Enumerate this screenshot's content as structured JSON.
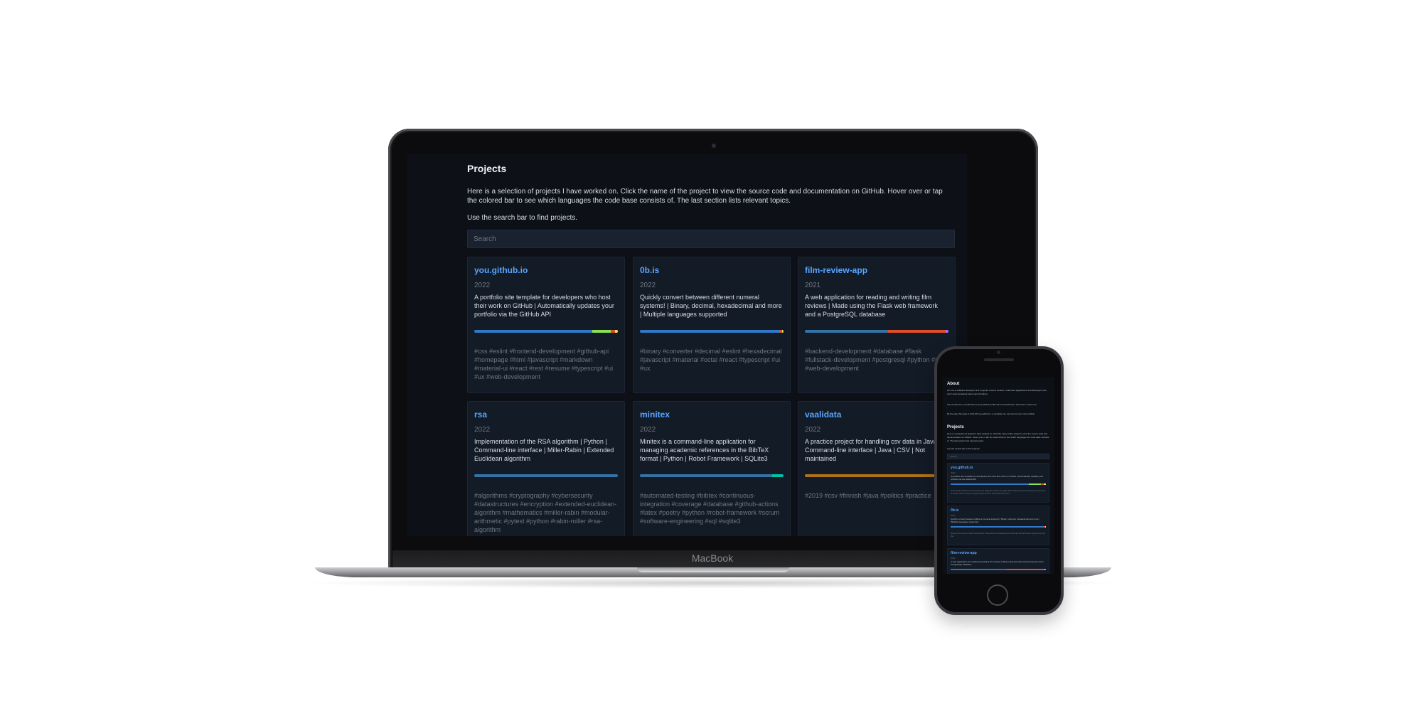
{
  "laptop": {
    "brand": "MacBook"
  },
  "projects": {
    "title": "Projects",
    "intro": "Here is a selection of projects I have worked on. Click the name of the project to view the source code and documentation on GitHub. Hover over or tap the colored bar to see which languages the code base consists of. The last section lists relevant topics.",
    "hint": "Use the search bar to find projects.",
    "search_placeholder": "Search",
    "cards": [
      {
        "name": "you.github.io",
        "year": "2022",
        "description": "A portfolio site template for developers who host their work on GitHub | Automatically updates your portfolio via the GitHub API",
        "topics": "#css #eslint #frontend-development #github-api #homepage #html #javascript #markdown #material-ui #react #rest #resume #typescript #ui #ux #web-development",
        "languages": [
          {
            "color": "#3178c6",
            "share": 0.82
          },
          {
            "color": "#89e051",
            "share": 0.13
          },
          {
            "color": "#e34c26",
            "share": 0.03
          },
          {
            "color": "#f1e05a",
            "share": 0.02
          }
        ]
      },
      {
        "name": "0b.is",
        "year": "2022",
        "description": "Quickly convert between different numeral systems! | Binary, decimal, hexadecimal and more | Multiple languages supported",
        "topics": "#binary #converter #decimal #eslint #hexadecimal #javascript #material #octal #react #typescript #ui #ux",
        "languages": [
          {
            "color": "#3178c6",
            "share": 0.97
          },
          {
            "color": "#e34c26",
            "share": 0.02
          },
          {
            "color": "#f1e05a",
            "share": 0.01
          }
        ]
      },
      {
        "name": "film-review-app",
        "year": "2021",
        "description": "A web application for reading and writing film reviews | Made using the Flask web framework and a PostgreSQL database",
        "topics": "#backend-development #database #flask #fullstack-development #postgresql #python #sql #web-development",
        "languages": [
          {
            "color": "#3572a5",
            "share": 0.58
          },
          {
            "color": "#e34c26",
            "share": 0.4
          },
          {
            "color": "#a371f7",
            "share": 0.02
          }
        ]
      },
      {
        "name": "rsa",
        "year": "2022",
        "description": "Implementation of the RSA algorithm | Python | Command-line interface | Miller-Rabin | Extended Euclidean algorithm",
        "topics": "#algorithms #cryptography #cybersecurity #datastructures #encryption #extended-euclidean-algorithm #mathematics #miller-rabin #modular-arithmetic #pytest #python #rabin-miller #rsa-algorithm",
        "languages": [
          {
            "color": "#3572a5",
            "share": 1.0
          }
        ]
      },
      {
        "name": "minitex",
        "year": "2022",
        "description": "Minitex is a command-line application for managing academic references in the BibTeX format | Python | Robot Framework | SQLite3",
        "topics": "#automated-testing #bibtex #continuous-integration #coverage #database #github-actions #latex #poetry #python #robot-framework #scrum #software-engineering #sql #sqlite3",
        "languages": [
          {
            "color": "#3572a5",
            "share": 0.92
          },
          {
            "color": "#00c2a8",
            "share": 0.08
          }
        ]
      },
      {
        "name": "vaalidata",
        "year": "2022",
        "description": "A practice project for handling csv data in Java | Command-line interface | Java | CSV | Not maintained",
        "topics": "#2019 #csv #finnish #java #politics #practice",
        "languages": [
          {
            "color": "#b07219",
            "share": 1.0
          }
        ]
      }
    ]
  },
  "phone": {
    "about_title": "About",
    "about_text": "Hi! I am a software developer and computer science student. I build web applications and developer tools, and I enjoy designing clean user interfaces.",
    "about_text2": "The contact form, social links and my GitHub profile can be found below. Feel free to reach out.",
    "about_text3": "By the way, this page is built with you.github.io, a template you can use for your own portfolio.",
    "projects_title": "Projects",
    "projects_text": "Here is a selection of projects I have worked on. Click the name of the project to view the source code and documentation on GitHub. Hover over or tap the colored bar to see which languages the code base consists of. The last section lists relevant topics.",
    "hint": "Use the search bar to find projects.",
    "search_placeholder": "Search"
  }
}
